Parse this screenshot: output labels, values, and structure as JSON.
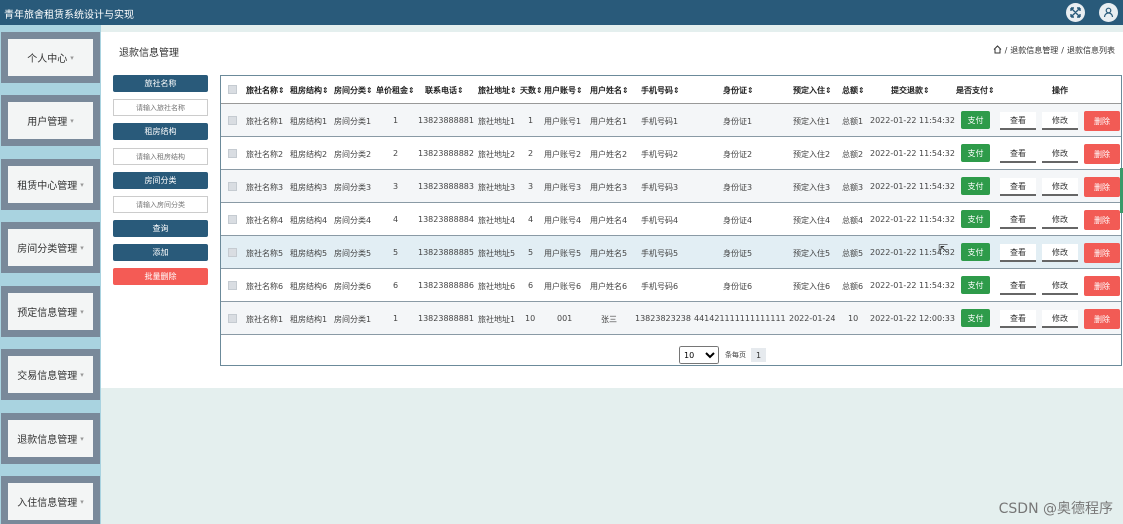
{
  "app": {
    "title": "青年旅舍租赁系统设计与实现"
  },
  "sidebar": {
    "items": [
      {
        "label": "个人中心"
      },
      {
        "label": "用户管理"
      },
      {
        "label": "租赁中心管理"
      },
      {
        "label": "房间分类管理"
      },
      {
        "label": "预定信息管理"
      },
      {
        "label": "交易信息管理"
      },
      {
        "label": "退款信息管理"
      },
      {
        "label": "入住信息管理"
      }
    ]
  },
  "page": {
    "title": "退款信息管理",
    "breadcrumb": [
      "退款信息管理",
      "退款信息列表"
    ]
  },
  "search": {
    "hostel_label": "旅社名称",
    "hostel_placeholder": "请输入旅社名称",
    "structure_label": "租房结构",
    "structure_placeholder": "请输入租房结构",
    "room_label": "房间分类",
    "room_placeholder": "请输入房间分类",
    "query_button": "查询",
    "add_button": "添加",
    "batch_delete_button": "批量删除"
  },
  "table": {
    "headers": [
      "旅社名称",
      "租房结构",
      "房间分类",
      "单价租金",
      "联系电话",
      "旅社地址",
      "天数",
      "用户账号",
      "用户姓名",
      "手机号码",
      "身份证",
      "预定入住",
      "总额",
      "提交退款",
      "是否支付",
      "操作"
    ],
    "pay_label": "支付",
    "view_label": "查看",
    "edit_label": "修改",
    "delete_label": "删除",
    "rows": [
      {
        "c": [
          "旅社名称1",
          "租房结构1",
          "房间分类1",
          "1",
          "13823888881",
          "旅社地址1",
          "1",
          "用户账号1",
          "用户姓名1",
          "手机号码1",
          "身份证1",
          "预定入住1",
          "总额1",
          "2022-01-22 11:54:32"
        ]
      },
      {
        "c": [
          "旅社名称2",
          "租房结构2",
          "房间分类2",
          "2",
          "13823888882",
          "旅社地址2",
          "2",
          "用户账号2",
          "用户姓名2",
          "手机号码2",
          "身份证2",
          "预定入住2",
          "总额2",
          "2022-01-22 11:54:32"
        ]
      },
      {
        "c": [
          "旅社名称3",
          "租房结构3",
          "房间分类3",
          "3",
          "13823888883",
          "旅社地址3",
          "3",
          "用户账号3",
          "用户姓名3",
          "手机号码3",
          "身份证3",
          "预定入住3",
          "总额3",
          "2022-01-22 11:54:32"
        ]
      },
      {
        "c": [
          "旅社名称4",
          "租房结构4",
          "房间分类4",
          "4",
          "13823888884",
          "旅社地址4",
          "4",
          "用户账号4",
          "用户姓名4",
          "手机号码4",
          "身份证4",
          "预定入住4",
          "总额4",
          "2022-01-22 11:54:32"
        ]
      },
      {
        "c": [
          "旅社名称5",
          "租房结构5",
          "房间分类5",
          "5",
          "13823888885",
          "旅社地址5",
          "5",
          "用户账号5",
          "用户姓名5",
          "手机号码5",
          "身份证5",
          "预定入住5",
          "总额5",
          "2022-01-22 11:54:32"
        ]
      },
      {
        "c": [
          "旅社名称6",
          "租房结构6",
          "房间分类6",
          "6",
          "13823888886",
          "旅社地址6",
          "6",
          "用户账号6",
          "用户姓名6",
          "手机号码6",
          "身份证6",
          "预定入住6",
          "总额6",
          "2022-01-22 11:54:32"
        ]
      },
      {
        "c": [
          "旅社名称1",
          "租房结构1",
          "房间分类1",
          "1",
          "13823888881",
          "旅社地址1",
          "10",
          "001",
          "张三",
          "13823823238",
          "441421111111111111",
          "2022-01-24",
          "10",
          "2022-01-22 12:00:33"
        ]
      }
    ]
  },
  "pager": {
    "page_size": "10",
    "per_page_label": "条每页",
    "current_page": "1"
  },
  "watermark": "CSDN @奥德程序",
  "colors": {
    "topbar": "#295a7a",
    "pay": "#2e9b4a",
    "delete": "#f25b55",
    "batch_delete": "#f45b55"
  }
}
